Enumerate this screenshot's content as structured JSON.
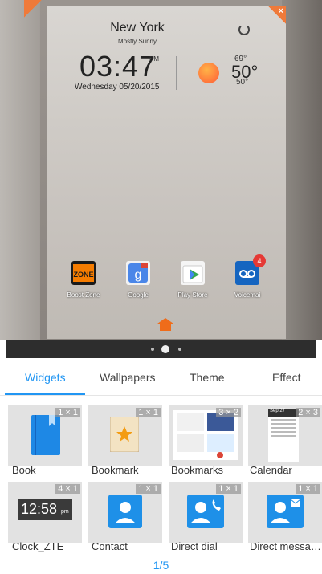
{
  "weather": {
    "city": "New York",
    "condition": "Mostly Sunny",
    "time": "03:47",
    "ampm": "PM",
    "day": "Wednesday",
    "date": "05/20/2015",
    "temp_high": "69°",
    "temp_current": "50°",
    "temp_low": "50°"
  },
  "apps": [
    {
      "label": "Boost Zone",
      "icon": "boost-zone-icon"
    },
    {
      "label": "Google",
      "icon": "google-icon"
    },
    {
      "label": "Play Store",
      "icon": "play-store-icon"
    },
    {
      "label": "Voicemai",
      "icon": "voicemail-icon",
      "badge": "4"
    }
  ],
  "tabs": [
    {
      "label": "Widgets",
      "active": true
    },
    {
      "label": "Wallpapers",
      "active": false
    },
    {
      "label": "Theme",
      "active": false
    },
    {
      "label": "Effect",
      "active": false
    }
  ],
  "widgets": [
    {
      "label": "Book",
      "size": "1 × 1",
      "icon": "book-icon"
    },
    {
      "label": "Bookmark",
      "size": "1 × 1",
      "icon": "bookmark-icon"
    },
    {
      "label": "Bookmarks",
      "size": "3 × 2",
      "icon": "bookmarks-preview"
    },
    {
      "label": "Calendar",
      "size": "2 × 3",
      "icon": "calendar-preview",
      "date": "Sep 27"
    },
    {
      "label": "Clock_ZTE",
      "size": "4 × 1",
      "icon": "clock-preview",
      "clock_time": "12:58",
      "clock_ampm": "pm"
    },
    {
      "label": "Contact",
      "size": "1 × 1",
      "icon": "contact-icon"
    },
    {
      "label": "Direct dial",
      "size": "1 × 1",
      "icon": "direct-dial-icon"
    },
    {
      "label": "Direct messa…",
      "size": "1 × 1",
      "icon": "direct-message-icon"
    }
  ],
  "pager": {
    "label": "1/5"
  },
  "colors": {
    "accent": "#2196f3",
    "corner": "#ef7a3a",
    "contact_blue": "#1e90e8"
  }
}
